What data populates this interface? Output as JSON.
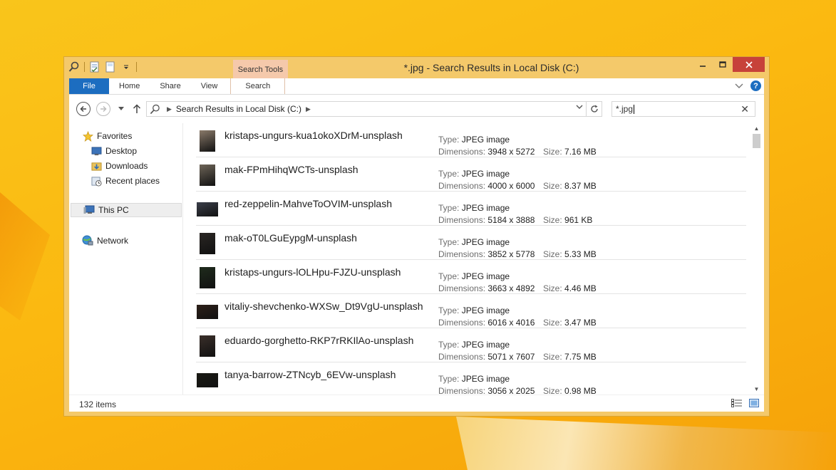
{
  "window": {
    "title": "*.jpg - Search Results in Local Disk (C:)",
    "context_tab": "Search Tools"
  },
  "ribbon": {
    "file": "File",
    "tabs": [
      "Home",
      "Share",
      "View"
    ],
    "search_tab": "Search"
  },
  "address": {
    "path": "Search Results in Local Disk (C:)"
  },
  "search": {
    "query": "*.jpg"
  },
  "navpane": {
    "favorites": "Favorites",
    "desktop": "Desktop",
    "downloads": "Downloads",
    "recent": "Recent places",
    "thispc": "This PC",
    "network": "Network"
  },
  "labels": {
    "type": "Type:",
    "dimensions": "Dimensions:",
    "size": "Size:"
  },
  "files": [
    {
      "name": "kristaps-ungurs-kua1okoXDrM-unsplash",
      "type": "JPEG image",
      "dimensions": "3948 x 5272",
      "size": "7.16 MB",
      "orientation": "portrait",
      "tone": "#8a7a6a"
    },
    {
      "name": "mak-FPmHihqWCTs-unsplash",
      "type": "JPEG image",
      "dimensions": "4000 x 6000",
      "size": "8.37 MB",
      "orientation": "portrait",
      "tone": "#6e6558"
    },
    {
      "name": "red-zeppelin-MahveToOVIM-unsplash",
      "type": "JPEG image",
      "dimensions": "5184 x 3888",
      "size": "961 KB",
      "orientation": "landscape",
      "tone": "#3b3f4a"
    },
    {
      "name": "mak-oT0LGuEypgM-unsplash",
      "type": "JPEG image",
      "dimensions": "3852 x 5778",
      "size": "5.33 MB",
      "orientation": "portrait",
      "tone": "#2a2623"
    },
    {
      "name": "kristaps-ungurs-lOLHpu-FJZU-unsplash",
      "type": "JPEG image",
      "dimensions": "3663 x 4892",
      "size": "4.46 MB",
      "orientation": "portrait",
      "tone": "#1f2b1c"
    },
    {
      "name": "vitaliy-shevchenko-WXSw_Dt9VgU-unsplash",
      "type": "JPEG image",
      "dimensions": "6016 x 4016",
      "size": "3.47 MB",
      "orientation": "landscape",
      "tone": "#2d2019"
    },
    {
      "name": "eduardo-gorghetto-RKP7rRKIlAo-unsplash",
      "type": "JPEG image",
      "dimensions": "5071 x 7607",
      "size": "7.75 MB",
      "orientation": "portrait",
      "tone": "#3a2f2a"
    },
    {
      "name": "tanya-barrow-ZTNcyb_6EVw-unsplash",
      "type": "JPEG image",
      "dimensions": "3056 x 2025",
      "size": "0.98 MB",
      "orientation": "landscape",
      "tone": "#1a1a14"
    }
  ],
  "status": {
    "items": "132 items"
  }
}
